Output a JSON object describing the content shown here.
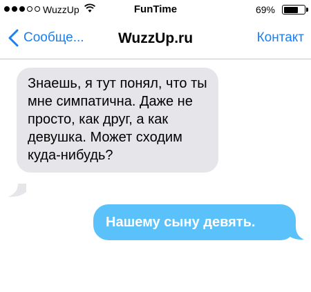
{
  "status_bar": {
    "carrier": "WuzzUp",
    "time": "FunTime",
    "battery_percent": "69%",
    "battery_level": 0.69,
    "signal_bars_filled": 3,
    "signal_bars_total": 5,
    "wifi_icon": "wifi-icon"
  },
  "nav": {
    "back_label": "Сообще...",
    "title": "WuzzUp.ru",
    "contact_label": "Контакт",
    "accent_color": "#1a7ff0"
  },
  "messages": {
    "incoming_text": "Знаешь, я тут понял, что ты мне симпатична. Даже не просто, как друг, а как девушка. Может сходим куда-нибудь?",
    "outgoing_text": "Нашему сыну девять.",
    "incoming_color": "#e5e5ea",
    "outgoing_color": "#5ac1fb"
  }
}
